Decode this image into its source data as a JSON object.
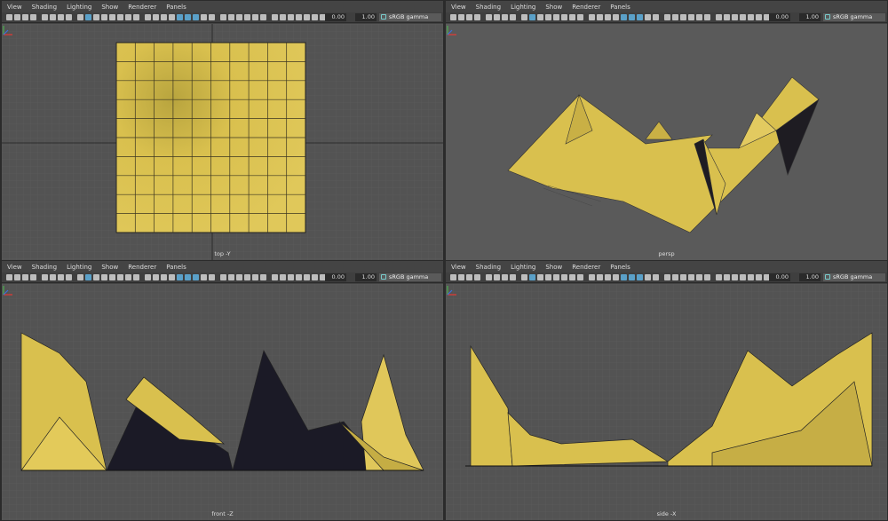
{
  "menu": [
    "View",
    "Shading",
    "Lighting",
    "Show",
    "Renderer",
    "Panels"
  ],
  "toolbar": {
    "exposure": "0.00",
    "gamma": "1.00",
    "colorspace": "sRGB gamma"
  },
  "panels": [
    {
      "id": "top",
      "camera": "top -Y"
    },
    {
      "id": "persp",
      "camera": "persp"
    },
    {
      "id": "front",
      "camera": "front -Z"
    },
    {
      "id": "side",
      "camera": "side -X"
    }
  ],
  "colors": {
    "surface": "#d9c04e",
    "surface_dark": "#1b1a26",
    "grid": "#5d5d5d",
    "wire": "#1a1a1a",
    "active_icon": "#5aa0c8"
  },
  "icons": [
    "camera-icon",
    "bookmark-icon",
    "grid-icon",
    "wireframe-icon",
    "shaded-icon",
    "textured-icon",
    "light-icon",
    "shadow-icon",
    "xray-icon",
    "isolate-icon",
    "exposure-icon",
    "gamma-icon",
    "colorspace-icon"
  ]
}
